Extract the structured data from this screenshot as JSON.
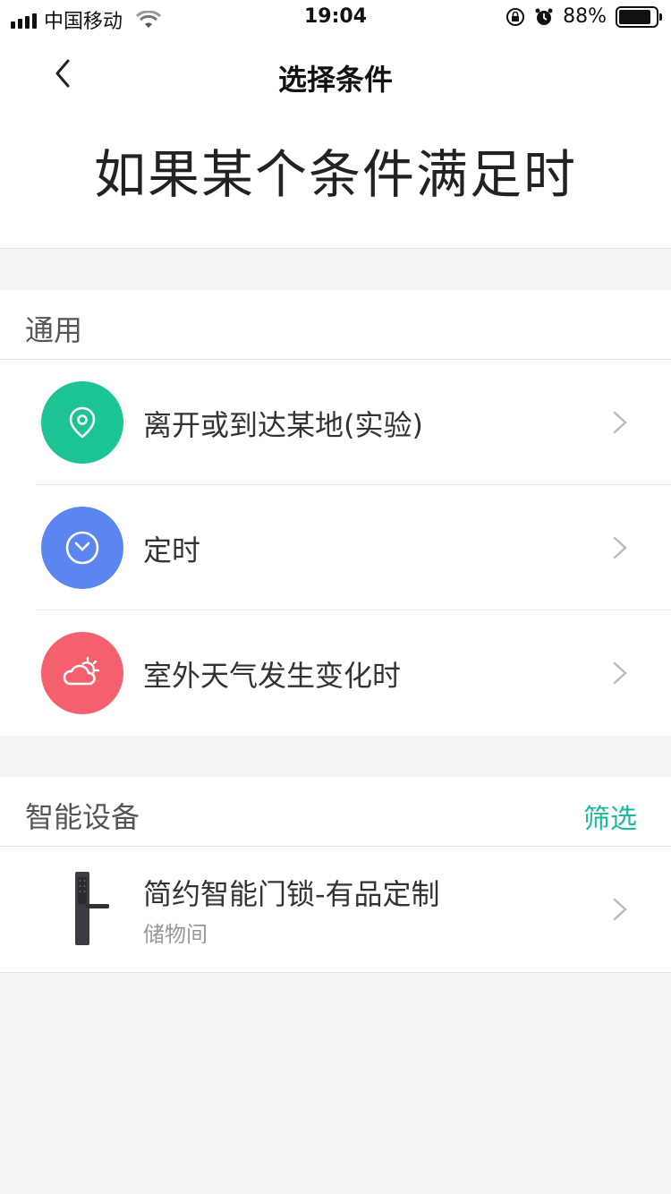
{
  "status_bar": {
    "carrier": "中国移动",
    "time": "19:04",
    "battery_percent": "88%",
    "battery_level": 0.88,
    "icons": [
      "signal-icon",
      "wifi-icon",
      "orientation-lock-icon",
      "alarm-icon",
      "battery-icon"
    ]
  },
  "nav": {
    "title": "选择条件",
    "back_icon": "chevron-left-icon"
  },
  "hero": {
    "title": "如果某个条件满足时"
  },
  "general": {
    "title": "通用",
    "items": [
      {
        "label": "离开或到达某地(实验)",
        "icon": "location-pin-icon",
        "color": "#1cc393"
      },
      {
        "label": "定时",
        "icon": "clock-icon",
        "color": "#5b86f0"
      },
      {
        "label": "室外天气发生变化时",
        "icon": "weather-icon",
        "color": "#f5606e"
      }
    ]
  },
  "devices": {
    "title": "智能设备",
    "filter_label": "筛选",
    "accent": "#1fb89e",
    "items": [
      {
        "name": "简约智能门锁-有品定制",
        "room": "储物间",
        "icon": "door-lock-icon"
      }
    ]
  }
}
